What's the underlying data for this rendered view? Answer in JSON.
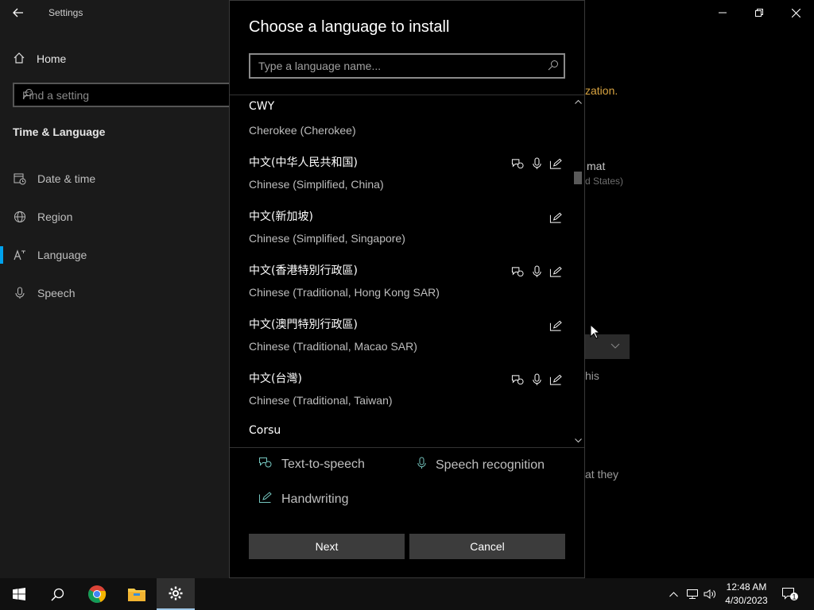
{
  "window": {
    "title": "Settings",
    "back_icon": "back-arrow-icon",
    "controls": [
      "minimize-icon",
      "restore-icon",
      "close-icon"
    ]
  },
  "sidebar": {
    "home_label": "Home",
    "search_placeholder": "Find a setting",
    "section_title": "Time & Language",
    "items": [
      {
        "label": "Date & time",
        "icon": "calendar-clock-icon"
      },
      {
        "label": "Region",
        "icon": "globe-icon"
      },
      {
        "label": "Language",
        "icon": "language-icon",
        "active": true
      },
      {
        "label": "Speech",
        "icon": "microphone-icon"
      }
    ]
  },
  "background_text": {
    "t1": "zation.",
    "t2": "mat",
    "t3": "d States)",
    "t4": "his",
    "t5": "at they"
  },
  "dialog": {
    "title": "Choose a language to install",
    "search_placeholder": "Type a language name...",
    "languages": [
      {
        "native": "CWY",
        "english": "Cherokee (Cherokee)",
        "features": []
      },
      {
        "native": "中文(中华人民共和国)",
        "english": "Chinese (Simplified, China)",
        "features": [
          "text-to-speech",
          "speech-recognition",
          "handwriting"
        ]
      },
      {
        "native": "中文(新加坡)",
        "english": "Chinese (Simplified, Singapore)",
        "features": [
          "handwriting"
        ]
      },
      {
        "native": "中文(香港特別行政區)",
        "english": "Chinese (Traditional, Hong Kong SAR)",
        "features": [
          "text-to-speech",
          "speech-recognition",
          "handwriting"
        ]
      },
      {
        "native": "中文(澳門特別行政區)",
        "english": "Chinese (Traditional, Macao SAR)",
        "features": [
          "handwriting"
        ]
      },
      {
        "native": "中文(台灣)",
        "english": "Chinese (Traditional, Taiwan)",
        "features": [
          "text-to-speech",
          "speech-recognition",
          "handwriting"
        ]
      },
      {
        "native": "Corsu",
        "english": "",
        "features": []
      }
    ],
    "legend": {
      "tts": "Text-to-speech",
      "speech": "Speech recognition",
      "handwriting": "Handwriting"
    },
    "next_label": "Next",
    "cancel_label": "Cancel",
    "scroll_position": 0.2
  },
  "taskbar": {
    "apps": [
      "windows-start-icon",
      "search-icon",
      "chrome-icon",
      "file-explorer-icon",
      "settings-gear-icon"
    ],
    "time": "12:48 AM",
    "date": "4/30/2023",
    "notification_count": "1"
  },
  "colors": {
    "accent": "#00a2ed",
    "icon_teal": "#76c7c0",
    "button_bg": "#3c3c3c"
  }
}
